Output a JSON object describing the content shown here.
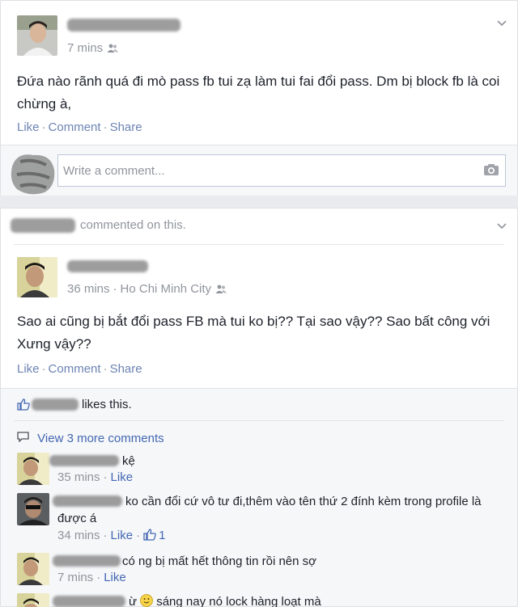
{
  "post1": {
    "timestamp": "7 mins",
    "text": "Đứa nào rãnh quá đi mò pass fb tui zạ làm tui fai đổi pass. Dm bị block fb là coi chừng à,",
    "actions": [
      "Like",
      "Comment",
      "Share"
    ],
    "comment_placeholder": "Write a comment..."
  },
  "post2": {
    "activity": "commented on this.",
    "activity_suffix": "n",
    "timestamp": "36 mins",
    "location": "Ho Chi Minh City",
    "text": "Sao ai cũng bị bắt đổi pass FB mà tui ko bị?? Tại sao vậy?? Sao bất công với Xưng vậy??",
    "actions": [
      "Like",
      "Comment",
      "Share"
    ],
    "likes_text": "likes this.",
    "view_more": "View 3 more comments",
    "comments": [
      {
        "text": "kệ",
        "time": "35 mins",
        "like": "Like",
        "like_count": ""
      },
      {
        "text": "ko cần đổi cứ vô tư đi,thêm vào tên thứ 2 đính kèm trong profile là",
        "text2": "được á",
        "time": "34 mins",
        "like": "Like",
        "like_count": "1"
      },
      {
        "text": "có ng bị mất hết thông tin rồi nên sợ",
        "time": "7 mins",
        "like": "Like",
        "like_count": ""
      },
      {
        "text": "ừ",
        "text_after_emoji": "sáng nay nó lock hàng loạt mà",
        "time": "",
        "like": "",
        "like_count": ""
      }
    ]
  },
  "icons": {
    "chevron": "chevron-down-icon",
    "friends": "friends-icon",
    "camera": "camera-icon",
    "thumb": "thumbs-up-icon",
    "comment": "comment-bubble-icon",
    "emoji": "smiley-emoji"
  },
  "colors": {
    "link": "#4267b2",
    "meta": "#90949c",
    "background": "#e9ebee"
  }
}
